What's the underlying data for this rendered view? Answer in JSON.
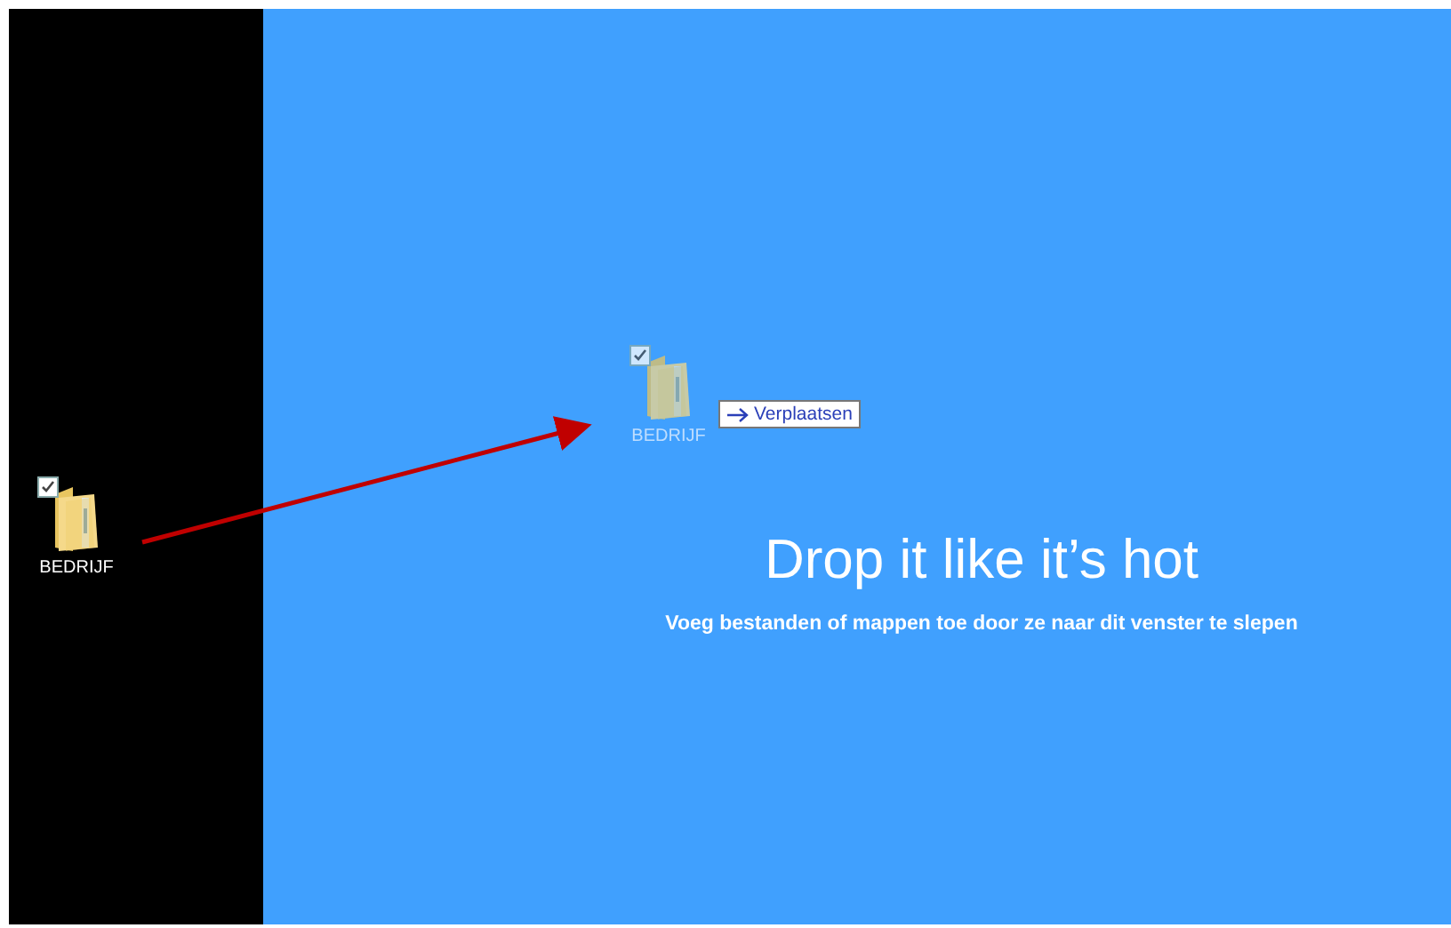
{
  "desktop": {
    "icon": {
      "label": "BEDRIJF",
      "checked": true
    }
  },
  "drop_zone": {
    "ghost_icon": {
      "label": "BEDRIJF",
      "checked": true
    },
    "tooltip": {
      "label": "Verplaatsen"
    },
    "title": "Drop it like it’s hot",
    "subtitle": "Voeg bestanden of mappen toe door ze naar dit venster te slepen"
  }
}
